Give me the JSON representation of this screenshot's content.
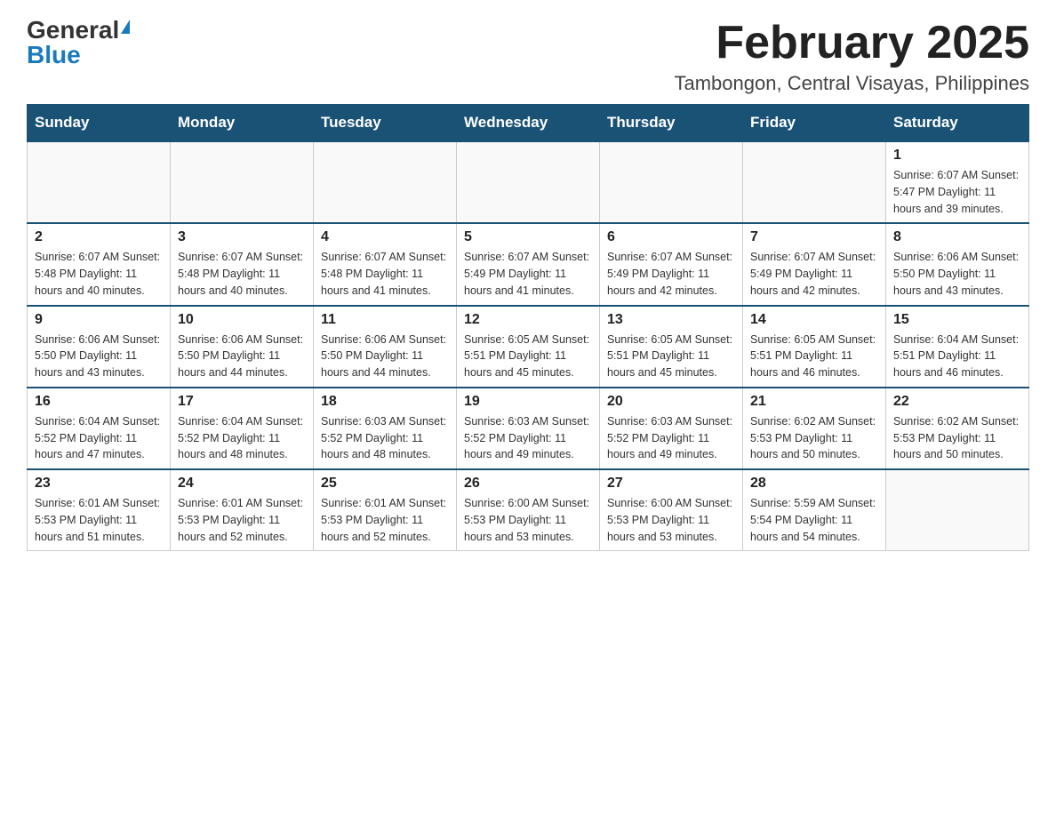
{
  "header": {
    "logo_general": "General",
    "logo_blue": "Blue",
    "month_title": "February 2025",
    "location": "Tambongon, Central Visayas, Philippines"
  },
  "weekdays": [
    "Sunday",
    "Monday",
    "Tuesday",
    "Wednesday",
    "Thursday",
    "Friday",
    "Saturday"
  ],
  "weeks": [
    [
      {
        "day": "",
        "info": ""
      },
      {
        "day": "",
        "info": ""
      },
      {
        "day": "",
        "info": ""
      },
      {
        "day": "",
        "info": ""
      },
      {
        "day": "",
        "info": ""
      },
      {
        "day": "",
        "info": ""
      },
      {
        "day": "1",
        "info": "Sunrise: 6:07 AM\nSunset: 5:47 PM\nDaylight: 11 hours and 39 minutes."
      }
    ],
    [
      {
        "day": "2",
        "info": "Sunrise: 6:07 AM\nSunset: 5:48 PM\nDaylight: 11 hours and 40 minutes."
      },
      {
        "day": "3",
        "info": "Sunrise: 6:07 AM\nSunset: 5:48 PM\nDaylight: 11 hours and 40 minutes."
      },
      {
        "day": "4",
        "info": "Sunrise: 6:07 AM\nSunset: 5:48 PM\nDaylight: 11 hours and 41 minutes."
      },
      {
        "day": "5",
        "info": "Sunrise: 6:07 AM\nSunset: 5:49 PM\nDaylight: 11 hours and 41 minutes."
      },
      {
        "day": "6",
        "info": "Sunrise: 6:07 AM\nSunset: 5:49 PM\nDaylight: 11 hours and 42 minutes."
      },
      {
        "day": "7",
        "info": "Sunrise: 6:07 AM\nSunset: 5:49 PM\nDaylight: 11 hours and 42 minutes."
      },
      {
        "day": "8",
        "info": "Sunrise: 6:06 AM\nSunset: 5:50 PM\nDaylight: 11 hours and 43 minutes."
      }
    ],
    [
      {
        "day": "9",
        "info": "Sunrise: 6:06 AM\nSunset: 5:50 PM\nDaylight: 11 hours and 43 minutes."
      },
      {
        "day": "10",
        "info": "Sunrise: 6:06 AM\nSunset: 5:50 PM\nDaylight: 11 hours and 44 minutes."
      },
      {
        "day": "11",
        "info": "Sunrise: 6:06 AM\nSunset: 5:50 PM\nDaylight: 11 hours and 44 minutes."
      },
      {
        "day": "12",
        "info": "Sunrise: 6:05 AM\nSunset: 5:51 PM\nDaylight: 11 hours and 45 minutes."
      },
      {
        "day": "13",
        "info": "Sunrise: 6:05 AM\nSunset: 5:51 PM\nDaylight: 11 hours and 45 minutes."
      },
      {
        "day": "14",
        "info": "Sunrise: 6:05 AM\nSunset: 5:51 PM\nDaylight: 11 hours and 46 minutes."
      },
      {
        "day": "15",
        "info": "Sunrise: 6:04 AM\nSunset: 5:51 PM\nDaylight: 11 hours and 46 minutes."
      }
    ],
    [
      {
        "day": "16",
        "info": "Sunrise: 6:04 AM\nSunset: 5:52 PM\nDaylight: 11 hours and 47 minutes."
      },
      {
        "day": "17",
        "info": "Sunrise: 6:04 AM\nSunset: 5:52 PM\nDaylight: 11 hours and 48 minutes."
      },
      {
        "day": "18",
        "info": "Sunrise: 6:03 AM\nSunset: 5:52 PM\nDaylight: 11 hours and 48 minutes."
      },
      {
        "day": "19",
        "info": "Sunrise: 6:03 AM\nSunset: 5:52 PM\nDaylight: 11 hours and 49 minutes."
      },
      {
        "day": "20",
        "info": "Sunrise: 6:03 AM\nSunset: 5:52 PM\nDaylight: 11 hours and 49 minutes."
      },
      {
        "day": "21",
        "info": "Sunrise: 6:02 AM\nSunset: 5:53 PM\nDaylight: 11 hours and 50 minutes."
      },
      {
        "day": "22",
        "info": "Sunrise: 6:02 AM\nSunset: 5:53 PM\nDaylight: 11 hours and 50 minutes."
      }
    ],
    [
      {
        "day": "23",
        "info": "Sunrise: 6:01 AM\nSunset: 5:53 PM\nDaylight: 11 hours and 51 minutes."
      },
      {
        "day": "24",
        "info": "Sunrise: 6:01 AM\nSunset: 5:53 PM\nDaylight: 11 hours and 52 minutes."
      },
      {
        "day": "25",
        "info": "Sunrise: 6:01 AM\nSunset: 5:53 PM\nDaylight: 11 hours and 52 minutes."
      },
      {
        "day": "26",
        "info": "Sunrise: 6:00 AM\nSunset: 5:53 PM\nDaylight: 11 hours and 53 minutes."
      },
      {
        "day": "27",
        "info": "Sunrise: 6:00 AM\nSunset: 5:53 PM\nDaylight: 11 hours and 53 minutes."
      },
      {
        "day": "28",
        "info": "Sunrise: 5:59 AM\nSunset: 5:54 PM\nDaylight: 11 hours and 54 minutes."
      },
      {
        "day": "",
        "info": ""
      }
    ]
  ]
}
